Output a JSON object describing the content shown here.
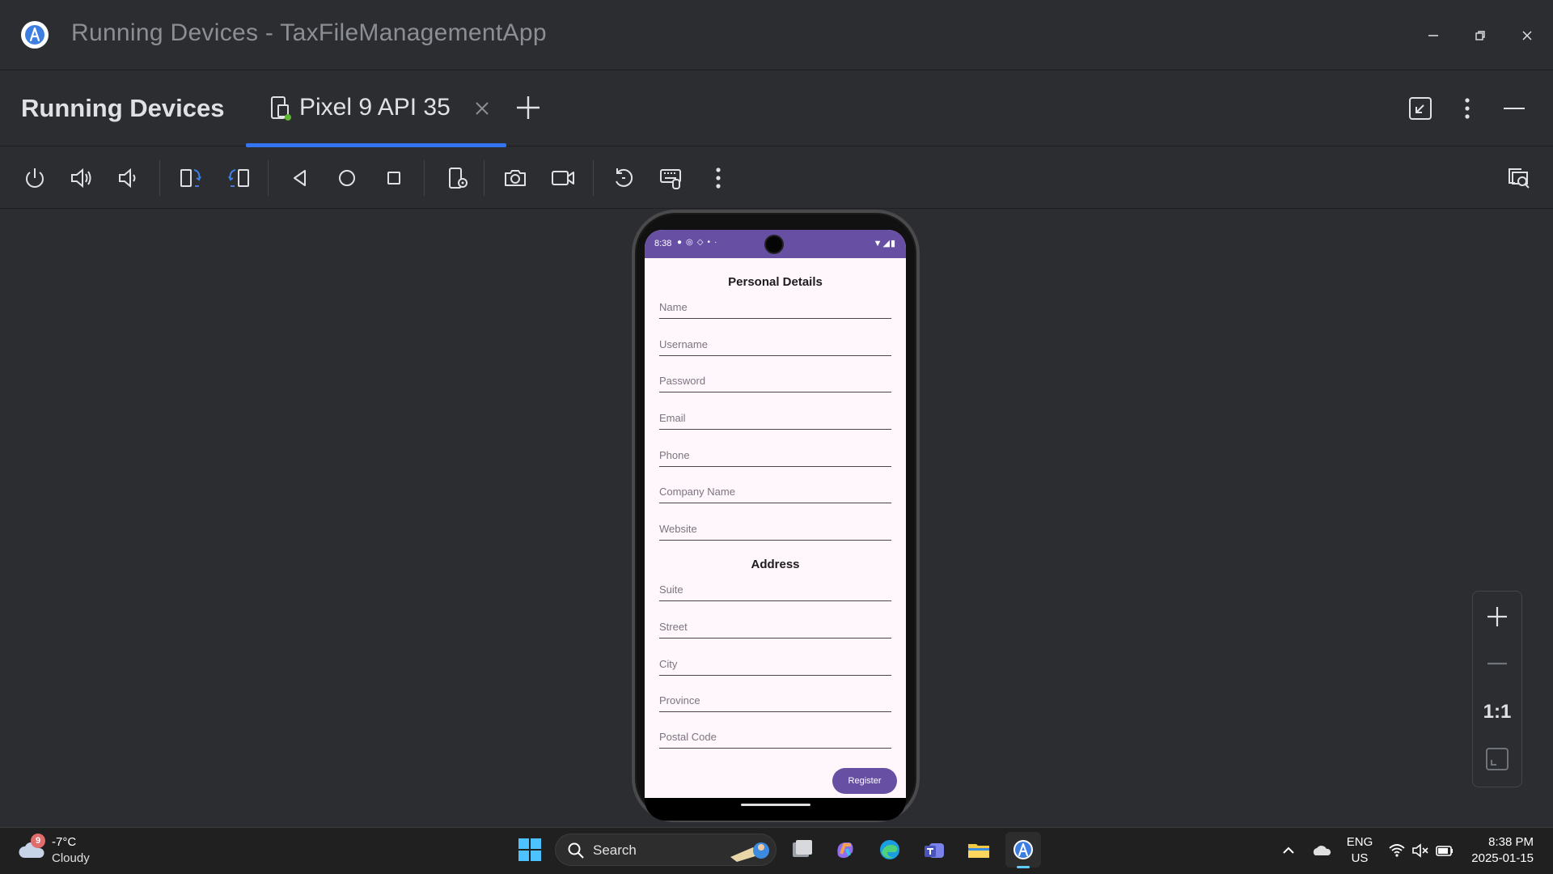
{
  "window": {
    "title": "Running Devices - TaxFileManagementApp",
    "controls": [
      "minimize-icon",
      "restore-icon",
      "close-icon"
    ]
  },
  "tool_window": {
    "title": "Running Devices",
    "tab_label": "Pixel 9 API 35",
    "icons": [
      "device-tab-icon",
      "close-tab-icon",
      "add-device-icon",
      "restore-layout-icon",
      "more-options-icon",
      "hide-icon"
    ]
  },
  "toolbar": {
    "buttons": [
      "power-icon",
      "volume-up-icon",
      "volume-down-icon",
      "rotate-left-icon",
      "rotate-right-icon",
      "back-icon",
      "home-icon",
      "overview-icon",
      "device-settings-icon",
      "screenshot-icon",
      "screen-record-icon",
      "reset-icon",
      "keyboard-input-icon",
      "more-icon",
      "inspect-icon"
    ]
  },
  "device": {
    "status_time": "8:38",
    "form": {
      "section1_title": "Personal Details",
      "fields1": [
        {
          "placeholder": "Name"
        },
        {
          "placeholder": "Username"
        },
        {
          "placeholder": "Password"
        },
        {
          "placeholder": "Email"
        },
        {
          "placeholder": "Phone"
        },
        {
          "placeholder": "Company Name"
        },
        {
          "placeholder": "Website"
        }
      ],
      "section2_title": "Address",
      "fields2": [
        {
          "placeholder": "Suite"
        },
        {
          "placeholder": "Street"
        },
        {
          "placeholder": "City"
        },
        {
          "placeholder": "Province"
        },
        {
          "placeholder": "Postal Code"
        }
      ],
      "submit_label": "Register"
    },
    "colors": {
      "primary": "#6750a4",
      "surface": "#fff7fb"
    }
  },
  "zoom": {
    "ratio_label": "1:1"
  },
  "taskbar": {
    "weather_badge": "9",
    "weather_temp": "-7°C",
    "weather_condition": "Cloudy",
    "search_label": "Search",
    "language_line1": "ENG",
    "language_line2": "US",
    "time": "8:38 PM",
    "date": "2025-01-15"
  }
}
